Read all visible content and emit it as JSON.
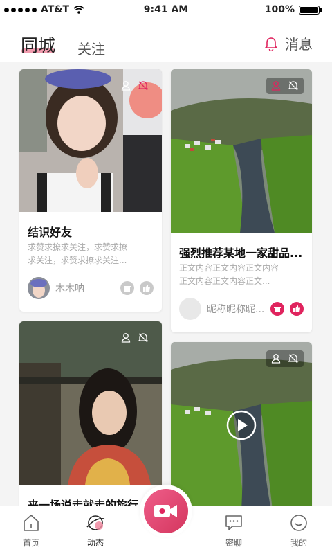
{
  "status_bar": {
    "carrier": "AT&T",
    "time": "9:41 AM",
    "battery": "100%"
  },
  "header": {
    "tab_city": "同城",
    "tab_follow": "关注",
    "messages_label": "消息"
  },
  "cards": [
    {
      "title": "结识好友",
      "desc_line1": "求赞求撩求关注，求赞求撩",
      "desc_line2": "求关注，求赞求撩求关注...",
      "author": "木木呐"
    },
    {
      "title": "强烈推荐某地一家甜品...",
      "desc_line1": "正文内容正文内容正文内容",
      "desc_line2": "正文内容正文内容正文...",
      "author": "昵称昵称昵..."
    },
    {
      "title": "来一场说走就走的旅行"
    },
    {
      "has_play": true
    }
  ],
  "tabbar": {
    "home": "首页",
    "moments": "动态",
    "chat": "密聊",
    "me": "我的"
  },
  "colors": {
    "accent": "#e0245e",
    "highlight": "#ef8aa0"
  },
  "icons": [
    "wifi-icon",
    "bell-icon",
    "play-icon",
    "camera-icon",
    "home-icon",
    "planet-icon",
    "chat-icon",
    "smile-icon"
  ]
}
